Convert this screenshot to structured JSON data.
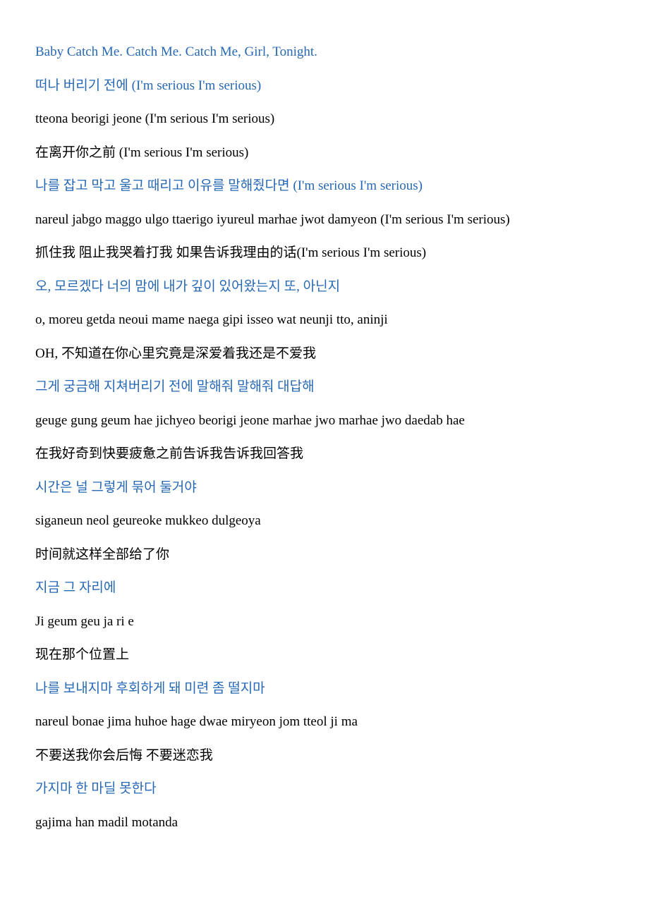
{
  "lines": [
    {
      "text": "Baby Catch Me. Catch Me. Catch Me, Girl, Tonight.",
      "color": "blue"
    },
    {
      "text": "떠나 버리기 전에 (I'm serious I'm serious)",
      "color": "blue"
    },
    {
      "text": "tteona beorigi jeone (I'm serious I'm serious)",
      "color": "black"
    },
    {
      "text": "在离开你之前 (I'm serious I'm serious)",
      "color": "black"
    },
    {
      "text": "나를 잡고 막고 울고 때리고 이유를 말해줬다면 (I'm serious I'm serious)",
      "color": "blue"
    },
    {
      "text": "nareul jabgo maggo ulgo ttaerigo iyureul marhae jwot damyeon (I'm serious I'm serious)",
      "color": "black"
    },
    {
      "text": "抓住我 阻止我哭着打我 如果告诉我理由的话(I'm serious I'm serious)",
      "color": "black"
    },
    {
      "text": "오, 모르겠다 너의 맘에 내가 깊이 있어왔는지 또, 아닌지",
      "color": "blue"
    },
    {
      "text": "o, moreu getda neoui mame naega gipi isseo wat neunji tto, aninji",
      "color": "black"
    },
    {
      "text": "OH, 不知道在你心里究竟是深爱着我还是不爱我",
      "color": "black"
    },
    {
      "text": "그게 궁금해 지쳐버리기 전에 말해줘 말해줘 대답해",
      "color": "blue"
    },
    {
      "text": "geuge gung geum hae jichyeo beorigi jeone marhae jwo marhae jwo daedab hae",
      "color": "black"
    },
    {
      "text": "在我好奇到快要疲惫之前告诉我告诉我回答我",
      "color": "black"
    },
    {
      "text": "시간은 널 그렇게 묶어 둘거야",
      "color": "blue"
    },
    {
      "text": "siganeun neol geureoke mukkeo dulgeoya",
      "color": "black"
    },
    {
      "text": "时间就这样全部给了你",
      "color": "black"
    },
    {
      "text": "지금 그 자리에",
      "color": "blue"
    },
    {
      "text": "Ji geum geu ja ri e",
      "color": "black"
    },
    {
      "text": "现在那个位置上",
      "color": "black"
    },
    {
      "text": "나를 보내지마 후회하게 돼 미련 좀 떨지마",
      "color": "blue"
    },
    {
      "text": "nareul bonae jima huhoe hage dwae miryeon jom tteol ji ma",
      "color": "black"
    },
    {
      "text": "不要送我你会后悔 不要迷恋我",
      "color": "black"
    },
    {
      "text": "가지마 한 마딜 못한다",
      "color": "blue"
    },
    {
      "text": "gajima han madil motanda",
      "color": "black"
    }
  ]
}
